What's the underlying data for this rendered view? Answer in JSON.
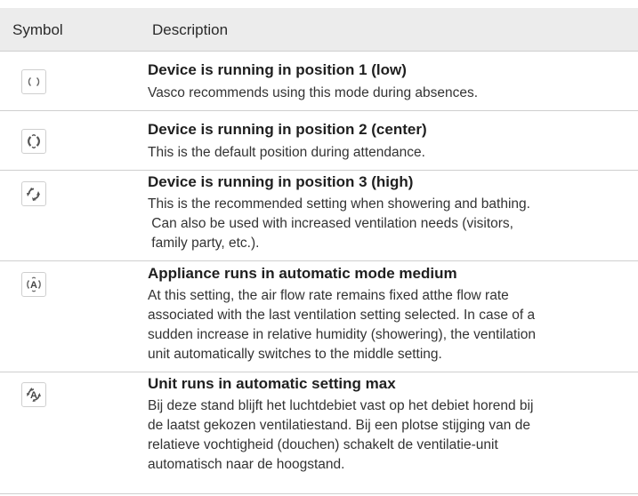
{
  "header": {
    "symbol": "Symbol",
    "description": "Description"
  },
  "rows": [
    {
      "icon": "fan-position-1-icon",
      "title": "Device is running in position 1 (low)",
      "lines": [
        "Vasco recommends using this mode during absences."
      ]
    },
    {
      "icon": "fan-position-2-icon",
      "title": "Device is running in position 2 (center)",
      "lines": [
        "This is the default position during attendance."
      ]
    },
    {
      "icon": "fan-position-3-icon",
      "title": "Device is running in position 3 (high)",
      "lines": [
        "This is the recommended setting when showering and bathing.",
        " Can also be used with increased ventilation needs (visitors,",
        " family party, etc.)."
      ]
    },
    {
      "icon": "auto-medium-icon",
      "icon_letter": "A",
      "title": "Appliance runs in automatic mode medium",
      "lines": [
        "At this setting, the air flow rate remains fixed atthe flow rate",
        "associated with the last ventilation setting selected. In case of a",
        "sudden increase in relative humidity (showering), the ventilation",
        "unit automatically switches to the middle setting."
      ]
    },
    {
      "icon": "auto-max-icon",
      "icon_letter": "A",
      "title": "Unit runs in automatic setting max",
      "lines": [
        "Bij deze stand blijft het luchtdebiet vast op het debiet horend bij",
        "de laatst gekozen ventilatiestand. Bij een plotse stijging van de",
        "relatieve vochtigheid (douchen) schakelt de ventilatie-unit",
        "automatisch naar de hoogstand."
      ]
    }
  ]
}
